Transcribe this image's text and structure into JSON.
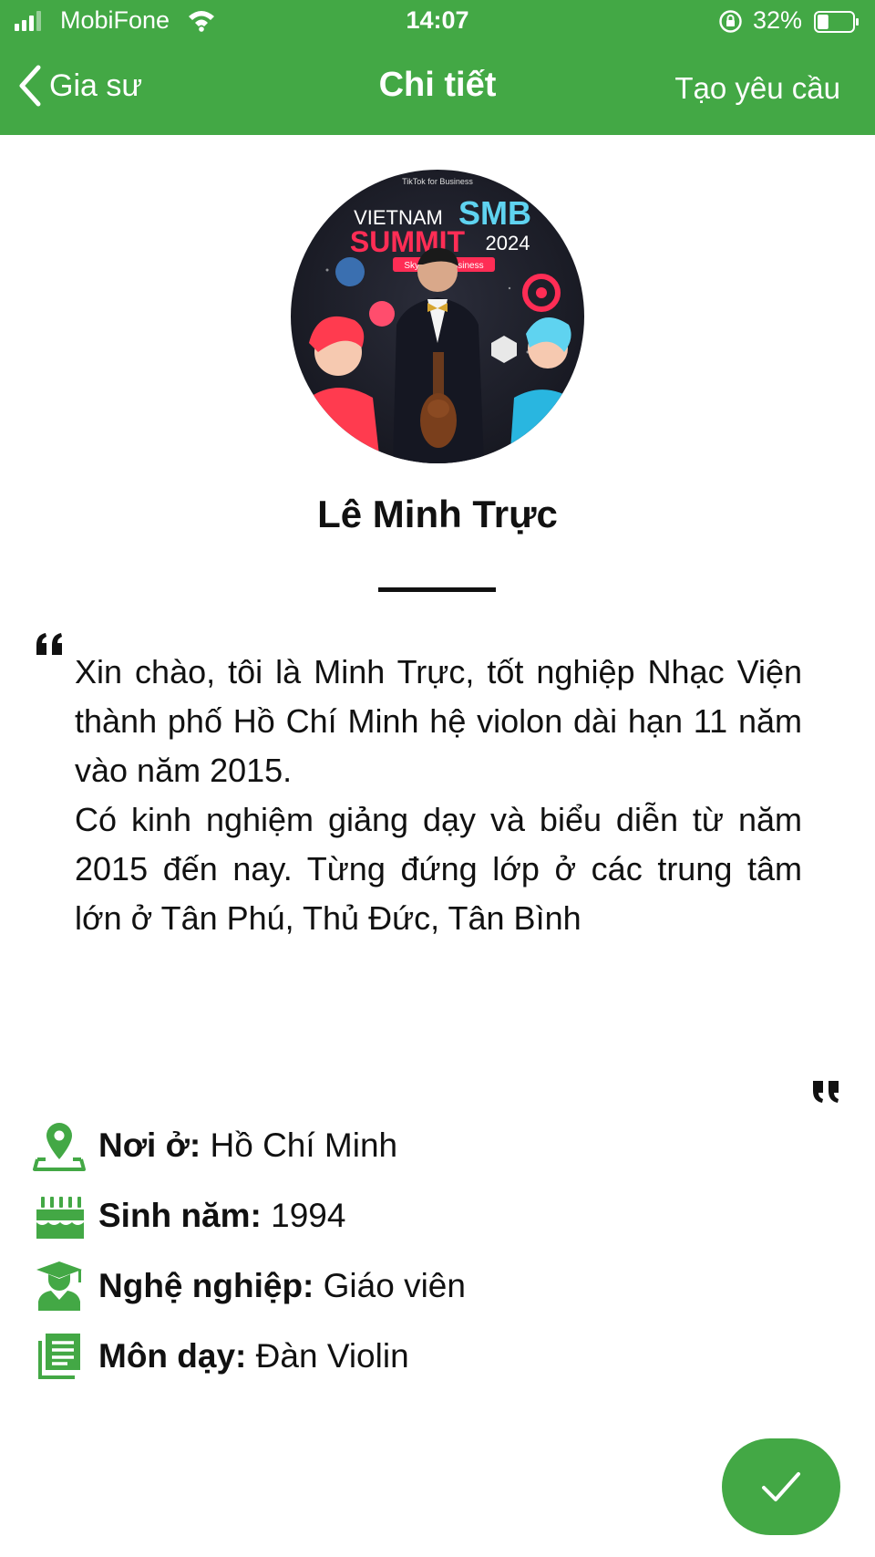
{
  "status_bar": {
    "carrier": "MobiFone",
    "time": "14:07",
    "battery": "32%",
    "battery_level": 0.32
  },
  "nav": {
    "back_label": "Gia sư",
    "title": "Chi tiết",
    "action_label": "Tạo yêu cầu"
  },
  "profile": {
    "name": "Lê Minh Trực",
    "avatar_backdrop_text": [
      "VIETNAM",
      "SMB",
      "SUMMIT",
      "2024",
      "Skyrocket Business",
      "TikTok for Business"
    ],
    "bio": [
      "Xin chào, tôi là Minh Trực, tốt nghiệp Nhạc Viện thành phố Hồ Chí Minh hệ violon dài hạn 11 năm vào năm 2015.",
      "Có kinh nghiệm giảng dạy và biểu diễn từ năm 2015 đến nay. Từng đứng lớp ở các trung tâm lớn ở Tân Phú, Thủ Đức, Tân Bình"
    ]
  },
  "info": [
    {
      "icon": "location-pin-icon",
      "label": "Nơi ở:",
      "value": " Hồ Chí Minh"
    },
    {
      "icon": "birthday-cake-icon",
      "label": "Sinh năm:",
      "value": " 1994"
    },
    {
      "icon": "graduate-icon",
      "label": "Nghệ nghiệp:",
      "value": " Giáo viên"
    },
    {
      "icon": "subject-list-icon",
      "label": "Môn dạy:",
      "value": " Đàn Violin"
    }
  ],
  "colors": {
    "brand_green": "#43a845",
    "text": "#111111",
    "background": "#ffffff"
  }
}
